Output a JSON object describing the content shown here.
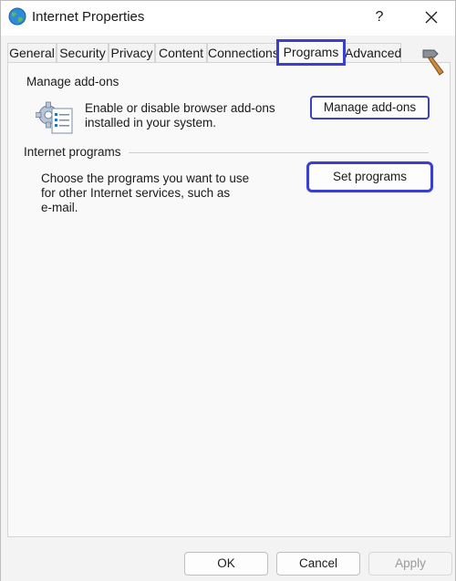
{
  "window": {
    "title": "Internet Properties",
    "help_label": "?"
  },
  "tabs": [
    {
      "label": "General"
    },
    {
      "label": "Security"
    },
    {
      "label": "Privacy"
    },
    {
      "label": "Content"
    },
    {
      "label": "Connections"
    },
    {
      "label": "Programs"
    },
    {
      "label": "Advanced"
    }
  ],
  "active_tab": "Programs",
  "manage_addons": {
    "group_label": "Manage add-ons",
    "description_line1": "Enable or disable browser add-ons",
    "description_line2": "installed in your system.",
    "button_label": "Manage add-ons"
  },
  "internet_programs": {
    "group_label": "Internet programs",
    "description_line1": "Choose the programs you want to use",
    "description_line2": "for other Internet services, such as",
    "description_line3": "e-mail.",
    "button_label": "Set programs"
  },
  "footer": {
    "ok_label": "OK",
    "cancel_label": "Cancel",
    "apply_label": "Apply"
  },
  "colors": {
    "highlight": "#3b3fcf",
    "window_bg": "#f3f3f3",
    "panel_bg": "#f9f9f9"
  }
}
